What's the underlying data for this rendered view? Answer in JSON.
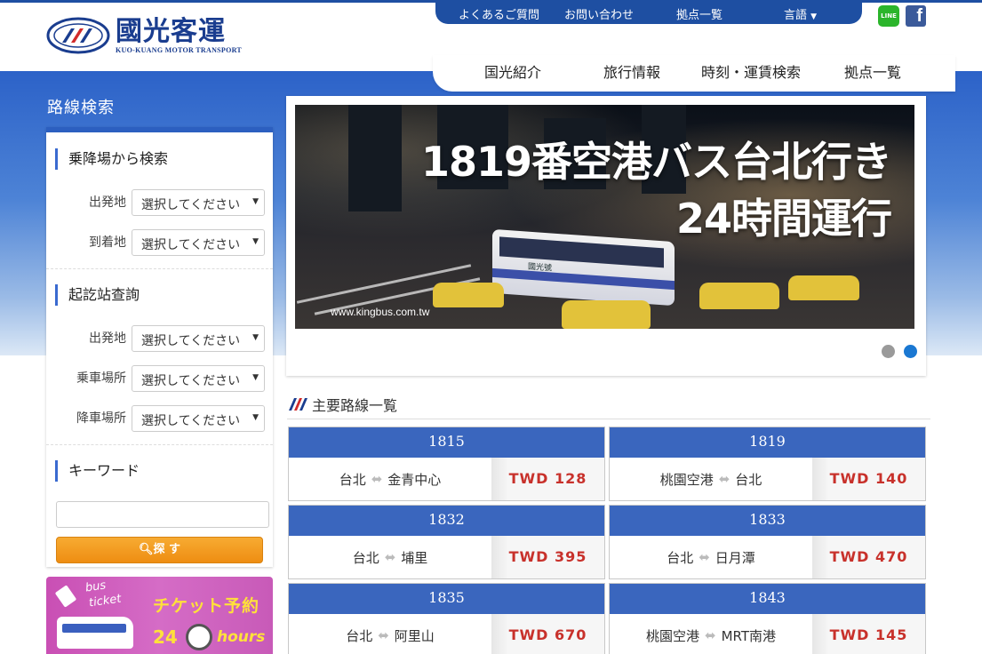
{
  "brand": {
    "name_cn": "國光客運",
    "name_en": "KUO-KUANG MOTOR TRANSPORT"
  },
  "topnav": {
    "faq": "よくあるご質問",
    "contact": "お問い合わせ",
    "locations": "拠点一覧",
    "language": "言語"
  },
  "social": {
    "line": "LINE",
    "facebook": "f"
  },
  "mainnav": {
    "about": "国光紹介",
    "travel": "旅行情報",
    "timetable": "時刻・運賃検索",
    "bases": "拠点一覧"
  },
  "sidebar": {
    "title": "路線検索",
    "section1": {
      "heading": "乗降場から検索",
      "departure_label": "出発地",
      "arrival_label": "到着地",
      "departure_value": "選択してください",
      "arrival_value": "選択してください"
    },
    "section2": {
      "heading": "起訖站查詢",
      "departure_label": "出発地",
      "boarding_label": "乗車場所",
      "alighting_label": "降車場所",
      "departure_value": "選択してください",
      "boarding_value": "選択してください",
      "alighting_value": "選択してください"
    },
    "section3": {
      "heading": "キーワード",
      "keyword_value": "",
      "search_label": "探 す"
    }
  },
  "ticket_banner": {
    "line1": "bus",
    "line2": "ticket",
    "title": "チケット予約",
    "num": "24",
    "hours": "hours"
  },
  "slider": {
    "headline1": "1819番空港バス台北行き",
    "headline2": "24時間運行",
    "url": "www.kingbus.com.tw",
    "bus_text": "國光號",
    "active_index": 2,
    "dot_count": 2
  },
  "routes": {
    "title": "主要路線一覧",
    "items": [
      {
        "number": "1815",
        "from": "台北",
        "to": "金青中心",
        "price": "TWD 128"
      },
      {
        "number": "1819",
        "from": "桃園空港",
        "to": "台北",
        "price": "TWD 140"
      },
      {
        "number": "1832",
        "from": "台北",
        "to": "埔里",
        "price": "TWD 395"
      },
      {
        "number": "1833",
        "from": "台北",
        "to": "日月潭",
        "price": "TWD 470"
      },
      {
        "number": "1835",
        "from": "台北",
        "to": "阿里山",
        "price": "TWD 670"
      },
      {
        "number": "1843",
        "from": "桃園空港",
        "to": "MRT南港",
        "price": "TWD 145"
      }
    ]
  },
  "colors": {
    "brand_blue": "#1e4fa2",
    "route_head": "#3a66be",
    "price_red": "#c8312b",
    "search_orange": "#f0961a"
  }
}
